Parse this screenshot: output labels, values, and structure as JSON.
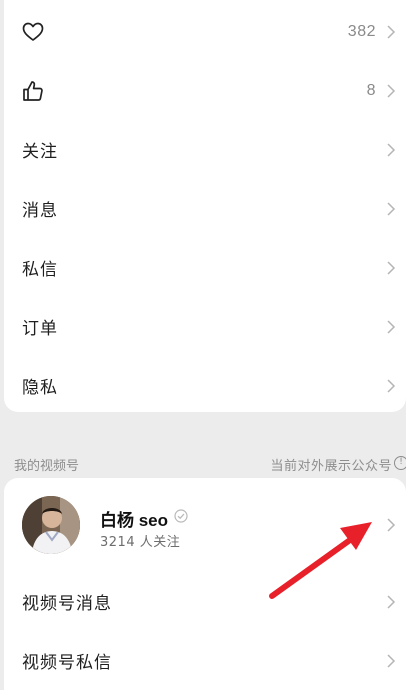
{
  "menu_top": {
    "favorites": {
      "icon": "heart-icon",
      "count": "382"
    },
    "likes": {
      "icon": "thumbs-up-icon",
      "count": "8"
    },
    "follow": {
      "label": "关注"
    },
    "messages": {
      "label": "消息"
    },
    "private_messages": {
      "label": "私信"
    },
    "orders": {
      "label": "订单"
    },
    "privacy": {
      "label": "隐私"
    }
  },
  "channels_section": {
    "title": "我的视频号",
    "right_text": "当前对外展示公众号",
    "right_icon": "info-icon"
  },
  "channel_profile": {
    "name": "白杨 seo",
    "followers": "3214 人关注",
    "verified_icon": "verified-badge-icon"
  },
  "channel_menu": {
    "messages": {
      "label": "视频号消息"
    },
    "private_messages": {
      "label": "视频号私信"
    }
  },
  "annotation": {
    "arrow_color": "#e8202a"
  }
}
